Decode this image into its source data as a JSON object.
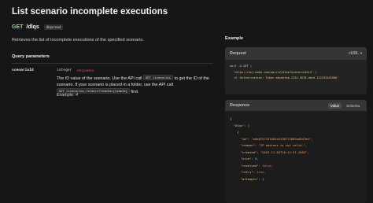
{
  "page": {
    "title": "List scenario incomplete executions",
    "method": "GET",
    "path": "/dlqs",
    "badge": "dlqs:read",
    "description": "Retrieves the list of incomplete executions of the specified scenario."
  },
  "query_parameters": {
    "section_title": "Query parameters",
    "param": {
      "name": "scenarioId",
      "type": "integer",
      "required_label": "REQUIRED",
      "desc_part1": "The ID value of the scenario. Use the API call",
      "code1": "GET /scenarios",
      "desc_part2": "to get the ID of the scenario. If your scenario is placed in a folder, use the API call",
      "code2": "GET /scenarios-folders?teamId={teamId}",
      "desc_part3": "first.",
      "example": "Example: 4"
    }
  },
  "example_panel": {
    "label": "Example",
    "request": {
      "title": "Request",
      "language": "cURL",
      "line1": "curl -X GET \\",
      "line2": "  'https://eu1.make.com/api/v2/dlqs?scenarioId=4' \\",
      "line3_prefix": "  -H ",
      "line3_string": "'Authorization: Token abcdefab-1234-5678-abcd-112233445566'"
    },
    "response": {
      "title": "Response",
      "tabs": [
        "Value",
        "Schema"
      ],
      "open_brace": "{",
      "dlqs_key": "\"dlqs\": [",
      "item_open": "{",
      "id_key": "\"id\":",
      "id_value": "\"ada8757331864c6198772089ad0d7dd\",",
      "reason_key": "\"reason\":",
      "reason_value": "\"IP address is not valid.\",",
      "created_key": "\"created\":",
      "created_value": "\"2019-11-04T10:12:57.260Z\",",
      "size_key": "\"size\":",
      "size_value": "5,",
      "resolved_key": "\"resolved\":",
      "resolved_value": "false,",
      "retry_key": "\"retry\":",
      "retry_value": "true,",
      "attempts_key": "\"attempts\":",
      "attempts_value": "1"
    }
  }
}
